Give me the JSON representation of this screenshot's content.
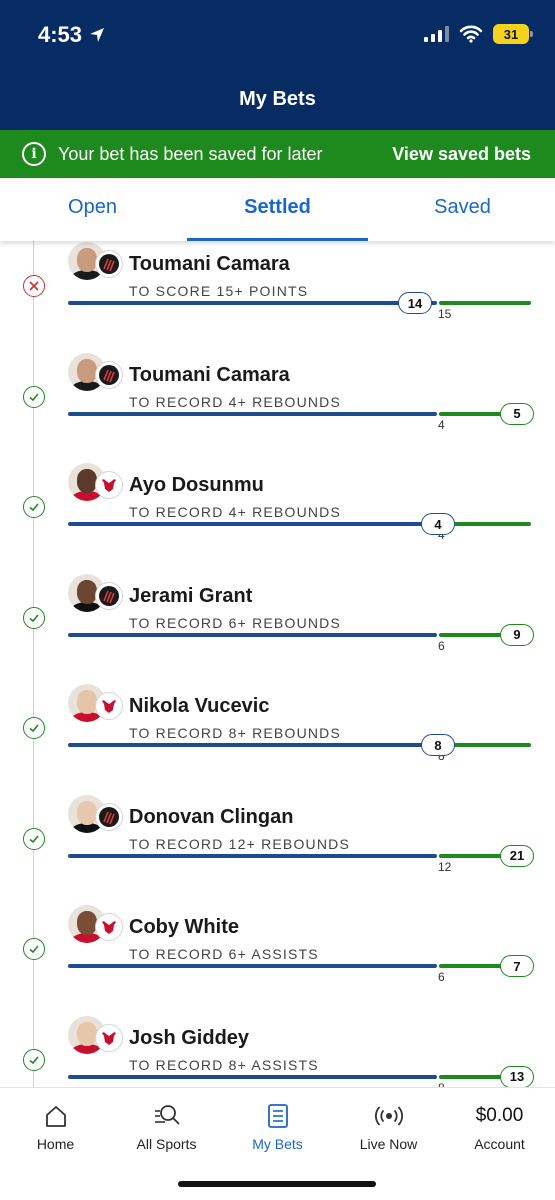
{
  "status_bar": {
    "time": "4:53",
    "battery": "31"
  },
  "header": {
    "title": "My Bets"
  },
  "banner": {
    "message": "Your bet has been saved for later",
    "link": "View saved bets"
  },
  "tabs": [
    {
      "label": "Open",
      "active": false
    },
    {
      "label": "Settled",
      "active": true
    },
    {
      "label": "Saved",
      "active": false
    }
  ],
  "bets": [
    {
      "player": "Toumani Camara",
      "market": "TO SCORE 15+ POINTS",
      "actual": "14",
      "target": "15",
      "result": "lost",
      "team": "portland"
    },
    {
      "player": "Toumani Camara",
      "market": "TO RECORD 4+ REBOUNDS",
      "actual": "5",
      "target": "4",
      "result": "won",
      "team": "portland"
    },
    {
      "player": "Ayo Dosunmu",
      "market": "TO RECORD 4+ REBOUNDS",
      "actual": "4",
      "target": "4",
      "result": "won",
      "team": "chicago"
    },
    {
      "player": "Jerami Grant",
      "market": "TO RECORD 6+ REBOUNDS",
      "actual": "9",
      "target": "6",
      "result": "won",
      "team": "portland"
    },
    {
      "player": "Nikola Vucevic",
      "market": "TO RECORD 8+ REBOUNDS",
      "actual": "8",
      "target": "8",
      "result": "won",
      "team": "chicago"
    },
    {
      "player": "Donovan Clingan",
      "market": "TO RECORD 12+ REBOUNDS",
      "actual": "21",
      "target": "12",
      "result": "won",
      "team": "portland"
    },
    {
      "player": "Coby White",
      "market": "TO RECORD 6+ ASSISTS",
      "actual": "7",
      "target": "6",
      "result": "won",
      "team": "chicago"
    },
    {
      "player": "Josh Giddey",
      "market": "TO RECORD 8+ ASSISTS",
      "actual": "13",
      "target": "8",
      "result": "won",
      "team": "chicago"
    }
  ],
  "colors": {
    "navy": "#072c64",
    "green": "#1e8a1e",
    "link_blue": "#1a66c9",
    "bar_blue": "#1d4d90",
    "lost_red": "#d03030"
  },
  "bottom_nav": [
    {
      "label": "Home",
      "icon": "home-icon"
    },
    {
      "label": "All Sports",
      "icon": "sports-search-icon"
    },
    {
      "label": "My Bets",
      "icon": "bet-slip-icon",
      "active": true
    },
    {
      "label": "Live Now",
      "icon": "live-broadcast-icon"
    },
    {
      "label": "Account",
      "balance": "$0.00"
    }
  ]
}
